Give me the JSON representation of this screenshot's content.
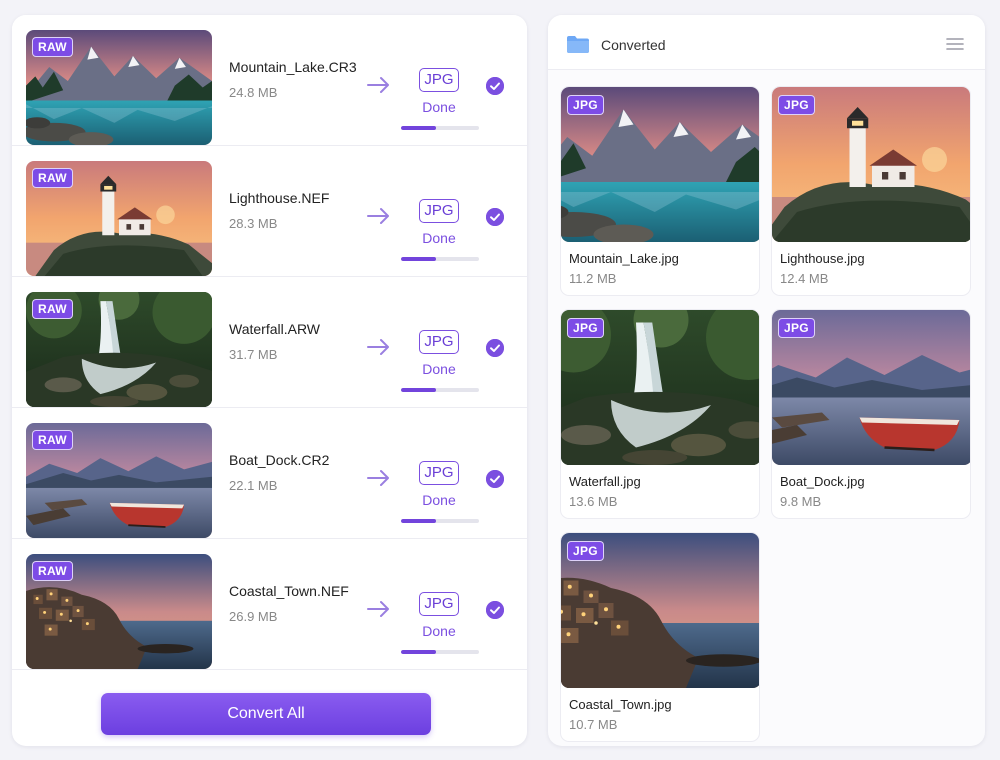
{
  "queue": {
    "items": [
      {
        "name": "Mountain_Lake.CR3",
        "size": "24.8 MB",
        "badge": "RAW",
        "target": "JPG",
        "status": "Done",
        "progress": 0.45
      },
      {
        "name": "Lighthouse.NEF",
        "size": "28.3 MB",
        "badge": "RAW",
        "target": "JPG",
        "status": "Done",
        "progress": 0.45
      },
      {
        "name": "Waterfall.ARW",
        "size": "31.7 MB",
        "badge": "RAW",
        "target": "JPG",
        "status": "Done",
        "progress": 0.45
      },
      {
        "name": "Boat_Dock.CR2",
        "size": "22.1 MB",
        "badge": "RAW",
        "target": "JPG",
        "status": "Done",
        "progress": 0.45
      },
      {
        "name": "Coastal_Town.NEF",
        "size": "26.9 MB",
        "badge": "RAW",
        "target": "JPG",
        "status": "Done",
        "progress": 0.45
      }
    ],
    "convert_label": "Convert All"
  },
  "converted": {
    "title": "Converted",
    "items": [
      {
        "name": "Mountain_Lake.jpg",
        "size": "11.2 MB",
        "badge": "JPG"
      },
      {
        "name": "Lighthouse.jpg",
        "size": "12.4 MB",
        "badge": "JPG"
      },
      {
        "name": "Waterfall.jpg",
        "size": "13.6 MB",
        "badge": "JPG"
      },
      {
        "name": "Boat_Dock.jpg",
        "size": "9.8 MB",
        "badge": "JPG"
      },
      {
        "name": "Coastal_Town.jpg",
        "size": "10.7 MB",
        "badge": "JPG"
      }
    ]
  },
  "icons": {
    "folder": "folder-icon",
    "menu": "list-menu-icon",
    "arrow": "arrow-right-icon",
    "check": "check-circle-icon"
  },
  "colors": {
    "accent": "#7b4fe0",
    "folder": "#6ea8f5"
  }
}
